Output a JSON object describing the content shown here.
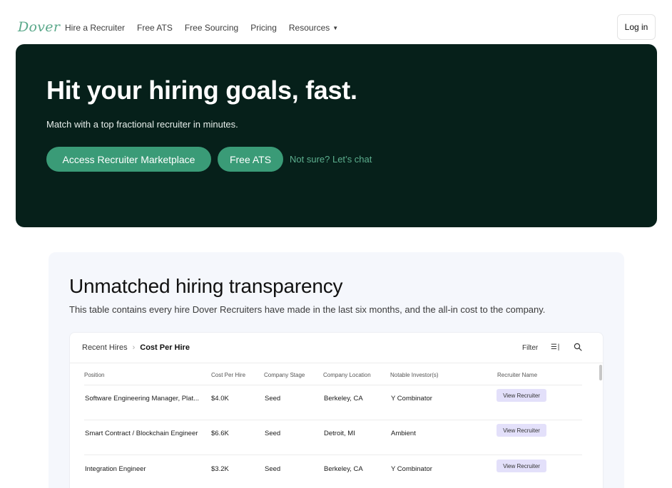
{
  "nav": {
    "logo": "Dover",
    "links": [
      "Hire a Recruiter",
      "Free ATS",
      "Free Sourcing",
      "Pricing",
      "Resources"
    ],
    "login_label": "Log in"
  },
  "hero": {
    "title": "Hit your hiring goals, fast.",
    "subtitle": "Match with a top fractional recruiter in minutes.",
    "primary_cta": "Access Recruiter Marketplace",
    "secondary_cta": "Free ATS",
    "chat_link": "Not sure? Let’s chat",
    "background_color": "#06201a",
    "accent_color": "#3a9b77"
  },
  "transparency": {
    "title": "Unmatched hiring transparency",
    "subtitle": "This table contains every hire Dover Recruiters have made in the last six months, and the all-in cost to the company.",
    "breadcrumb": [
      "Recent Hires",
      "Cost Per Hire"
    ],
    "toolbar": {
      "filter_label": "Filter",
      "columns_icon": "columns-icon",
      "search_icon": "search-icon"
    },
    "columns": [
      "Position",
      "Cost Per Hire",
      "Company Stage",
      "Company Location",
      "Notable Investor(s)",
      "Recruiter Name"
    ],
    "rows": [
      {
        "position": "Software Engineering Manager, Plat...",
        "cost": "$4.0K",
        "stage": "Seed",
        "location": "Berkeley, CA",
        "investor": "Y Combinator",
        "recruiter": "View Recruiter"
      },
      {
        "position": "Smart Contract / Blockchain Engineer",
        "cost": "$6.6K",
        "stage": "Seed",
        "location": "Detroit, MI",
        "investor": "Ambient",
        "recruiter": "View Recruiter"
      },
      {
        "position": "Integration Engineer",
        "cost": "$3.2K",
        "stage": "Seed",
        "location": "Berkeley, CA",
        "investor": "Y Combinator",
        "recruiter": "View Recruiter"
      }
    ]
  }
}
